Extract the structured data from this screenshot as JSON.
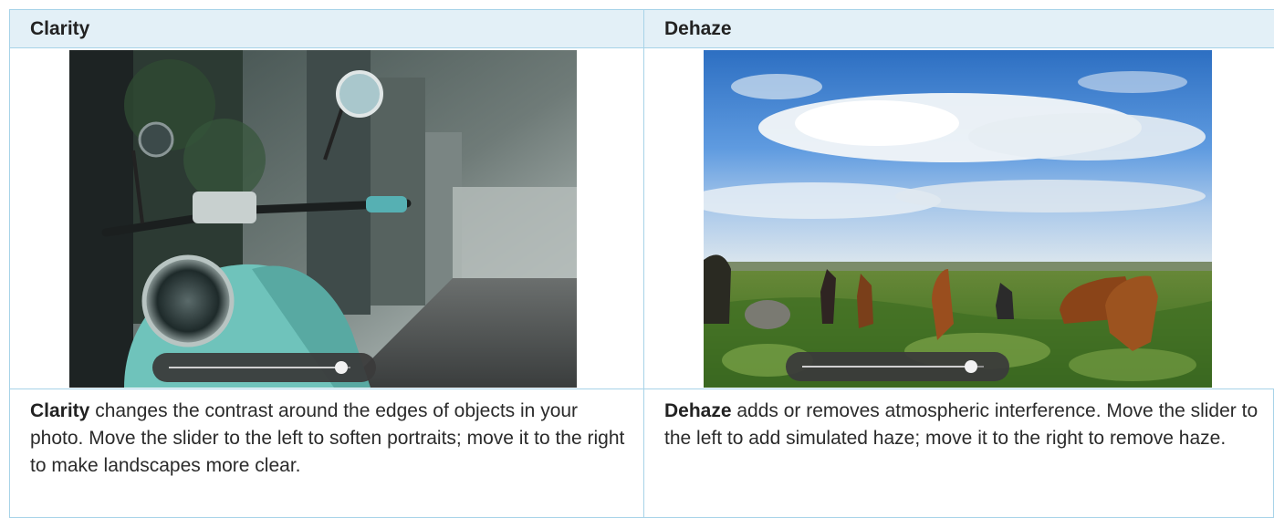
{
  "columns": [
    {
      "id": "clarity",
      "header": "Clarity",
      "slider_value": 0.95,
      "description_term": "Clarity",
      "description_rest": " changes the contrast around the edges of objects in your photo. Move the slider to the left to soften portraits; move it to the right to make landscapes more clear."
    },
    {
      "id": "dehaze",
      "header": "Dehaze",
      "slider_value": 0.93,
      "description_term": "Dehaze",
      "description_rest": " adds or removes atmospheric interference. Move the slider to the left to add simulated haze; move it to the right to remove haze."
    }
  ],
  "colors": {
    "border": "#a7d3e8",
    "header_bg": "#e3f0f7",
    "slider_bg": "#3a3a3a"
  }
}
